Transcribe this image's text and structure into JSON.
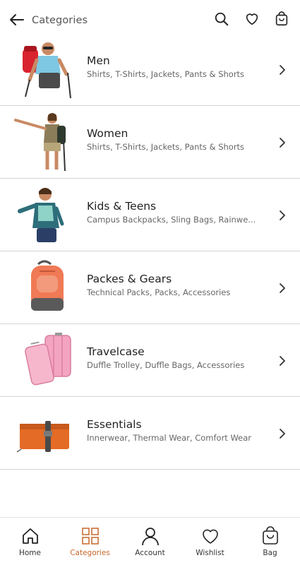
{
  "header": {
    "title": "Categories"
  },
  "categories": [
    {
      "title": "Men",
      "subtitle": "Shirts, T-Shirts, Jackets, Pants & Shorts"
    },
    {
      "title": "Women",
      "subtitle": "Shirts, T-Shirts, Jackets, Pants & Shorts"
    },
    {
      "title": "Kids & Teens",
      "subtitle": "Campus Backpacks, Sling Bags, Rainwe..."
    },
    {
      "title": "Packes & Gears",
      "subtitle": "Technical Packs, Packs, Accessories"
    },
    {
      "title": "Travelcase",
      "subtitle": "Duffle Trolley, Duffle Bags, Accessories"
    },
    {
      "title": "Essentials",
      "subtitle": "Innerwear, Thermal Wear, Comfort Wear"
    }
  ],
  "nav": {
    "home": "Home",
    "categories": "Categories",
    "account": "Account",
    "wishlist": "Wishlist",
    "bag": "Bag"
  },
  "colors": {
    "accent": "#c7662a",
    "divider": "#d4d4d4"
  },
  "icons": [
    "back-arrow-icon",
    "search-icon",
    "heart-icon",
    "bag-icon",
    "chevron-right-icon",
    "home-icon",
    "categories-grid-icon",
    "account-icon",
    "wishlist-icon",
    "bag-icon"
  ]
}
